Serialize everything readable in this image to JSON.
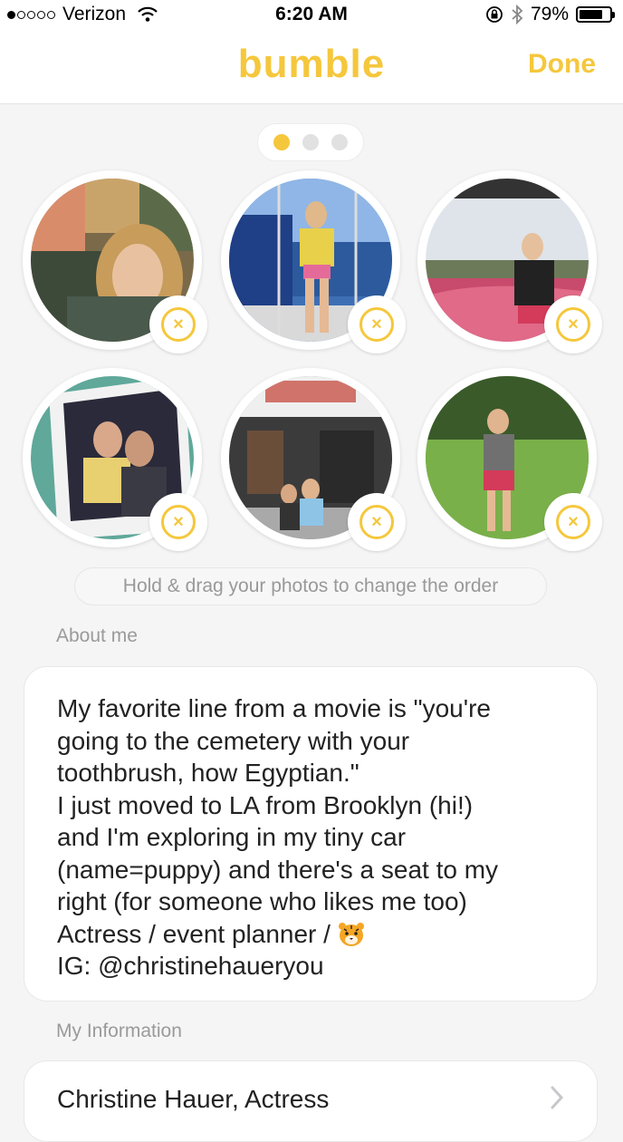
{
  "status_bar": {
    "carrier": "Verizon",
    "time": "6:20 AM",
    "battery": "79%",
    "battery_level": 0.79
  },
  "nav": {
    "logo": "bumble",
    "done_label": "Done"
  },
  "pager": {
    "pages": 3,
    "active": 0
  },
  "photos": [
    {
      "name": "photo-1"
    },
    {
      "name": "photo-2"
    },
    {
      "name": "photo-3"
    },
    {
      "name": "photo-4"
    },
    {
      "name": "photo-5"
    },
    {
      "name": "photo-6"
    }
  ],
  "hint": "Hold & drag your photos to change the order",
  "about": {
    "label": "About me",
    "lines": [
      "My favorite line from a movie is \"you're",
      "going to the cemetery with your",
      "toothbrush, how Egyptian.\"",
      "I just moved to LA from Brooklyn (hi!)",
      "and I'm exploring in my tiny car",
      "(name=puppy) and there's a seat to my",
      "right (for someone who likes me too)",
      "Actress / event planner / ",
      "IG: @christinehaueryou"
    ]
  },
  "my_information": {
    "label": "My Information",
    "name_occupation": "Christine Hauer, Actress"
  },
  "colors": {
    "accent": "#f5c73c",
    "background": "#f5f5f5"
  }
}
